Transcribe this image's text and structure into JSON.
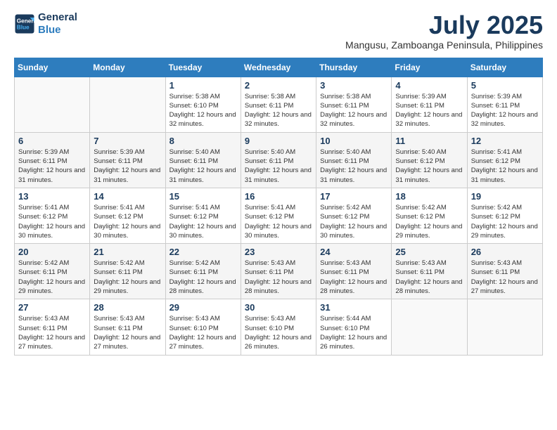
{
  "logo": {
    "line1": "General",
    "line2": "Blue"
  },
  "title": "July 2025",
  "subtitle": "Mangusu, Zamboanga Peninsula, Philippines",
  "weekdays": [
    "Sunday",
    "Monday",
    "Tuesday",
    "Wednesday",
    "Thursday",
    "Friday",
    "Saturday"
  ],
  "weeks": [
    [
      {
        "day": "",
        "info": ""
      },
      {
        "day": "",
        "info": ""
      },
      {
        "day": "1",
        "info": "Sunrise: 5:38 AM\nSunset: 6:10 PM\nDaylight: 12 hours and 32 minutes."
      },
      {
        "day": "2",
        "info": "Sunrise: 5:38 AM\nSunset: 6:11 PM\nDaylight: 12 hours and 32 minutes."
      },
      {
        "day": "3",
        "info": "Sunrise: 5:38 AM\nSunset: 6:11 PM\nDaylight: 12 hours and 32 minutes."
      },
      {
        "day": "4",
        "info": "Sunrise: 5:39 AM\nSunset: 6:11 PM\nDaylight: 12 hours and 32 minutes."
      },
      {
        "day": "5",
        "info": "Sunrise: 5:39 AM\nSunset: 6:11 PM\nDaylight: 12 hours and 32 minutes."
      }
    ],
    [
      {
        "day": "6",
        "info": "Sunrise: 5:39 AM\nSunset: 6:11 PM\nDaylight: 12 hours and 31 minutes."
      },
      {
        "day": "7",
        "info": "Sunrise: 5:39 AM\nSunset: 6:11 PM\nDaylight: 12 hours and 31 minutes."
      },
      {
        "day": "8",
        "info": "Sunrise: 5:40 AM\nSunset: 6:11 PM\nDaylight: 12 hours and 31 minutes."
      },
      {
        "day": "9",
        "info": "Sunrise: 5:40 AM\nSunset: 6:11 PM\nDaylight: 12 hours and 31 minutes."
      },
      {
        "day": "10",
        "info": "Sunrise: 5:40 AM\nSunset: 6:11 PM\nDaylight: 12 hours and 31 minutes."
      },
      {
        "day": "11",
        "info": "Sunrise: 5:40 AM\nSunset: 6:12 PM\nDaylight: 12 hours and 31 minutes."
      },
      {
        "day": "12",
        "info": "Sunrise: 5:41 AM\nSunset: 6:12 PM\nDaylight: 12 hours and 31 minutes."
      }
    ],
    [
      {
        "day": "13",
        "info": "Sunrise: 5:41 AM\nSunset: 6:12 PM\nDaylight: 12 hours and 30 minutes."
      },
      {
        "day": "14",
        "info": "Sunrise: 5:41 AM\nSunset: 6:12 PM\nDaylight: 12 hours and 30 minutes."
      },
      {
        "day": "15",
        "info": "Sunrise: 5:41 AM\nSunset: 6:12 PM\nDaylight: 12 hours and 30 minutes."
      },
      {
        "day": "16",
        "info": "Sunrise: 5:41 AM\nSunset: 6:12 PM\nDaylight: 12 hours and 30 minutes."
      },
      {
        "day": "17",
        "info": "Sunrise: 5:42 AM\nSunset: 6:12 PM\nDaylight: 12 hours and 30 minutes."
      },
      {
        "day": "18",
        "info": "Sunrise: 5:42 AM\nSunset: 6:12 PM\nDaylight: 12 hours and 29 minutes."
      },
      {
        "day": "19",
        "info": "Sunrise: 5:42 AM\nSunset: 6:12 PM\nDaylight: 12 hours and 29 minutes."
      }
    ],
    [
      {
        "day": "20",
        "info": "Sunrise: 5:42 AM\nSunset: 6:11 PM\nDaylight: 12 hours and 29 minutes."
      },
      {
        "day": "21",
        "info": "Sunrise: 5:42 AM\nSunset: 6:11 PM\nDaylight: 12 hours and 29 minutes."
      },
      {
        "day": "22",
        "info": "Sunrise: 5:42 AM\nSunset: 6:11 PM\nDaylight: 12 hours and 28 minutes."
      },
      {
        "day": "23",
        "info": "Sunrise: 5:43 AM\nSunset: 6:11 PM\nDaylight: 12 hours and 28 minutes."
      },
      {
        "day": "24",
        "info": "Sunrise: 5:43 AM\nSunset: 6:11 PM\nDaylight: 12 hours and 28 minutes."
      },
      {
        "day": "25",
        "info": "Sunrise: 5:43 AM\nSunset: 6:11 PM\nDaylight: 12 hours and 28 minutes."
      },
      {
        "day": "26",
        "info": "Sunrise: 5:43 AM\nSunset: 6:11 PM\nDaylight: 12 hours and 27 minutes."
      }
    ],
    [
      {
        "day": "27",
        "info": "Sunrise: 5:43 AM\nSunset: 6:11 PM\nDaylight: 12 hours and 27 minutes."
      },
      {
        "day": "28",
        "info": "Sunrise: 5:43 AM\nSunset: 6:11 PM\nDaylight: 12 hours and 27 minutes."
      },
      {
        "day": "29",
        "info": "Sunrise: 5:43 AM\nSunset: 6:10 PM\nDaylight: 12 hours and 27 minutes."
      },
      {
        "day": "30",
        "info": "Sunrise: 5:43 AM\nSunset: 6:10 PM\nDaylight: 12 hours and 26 minutes."
      },
      {
        "day": "31",
        "info": "Sunrise: 5:44 AM\nSunset: 6:10 PM\nDaylight: 12 hours and 26 minutes."
      },
      {
        "day": "",
        "info": ""
      },
      {
        "day": "",
        "info": ""
      }
    ]
  ]
}
